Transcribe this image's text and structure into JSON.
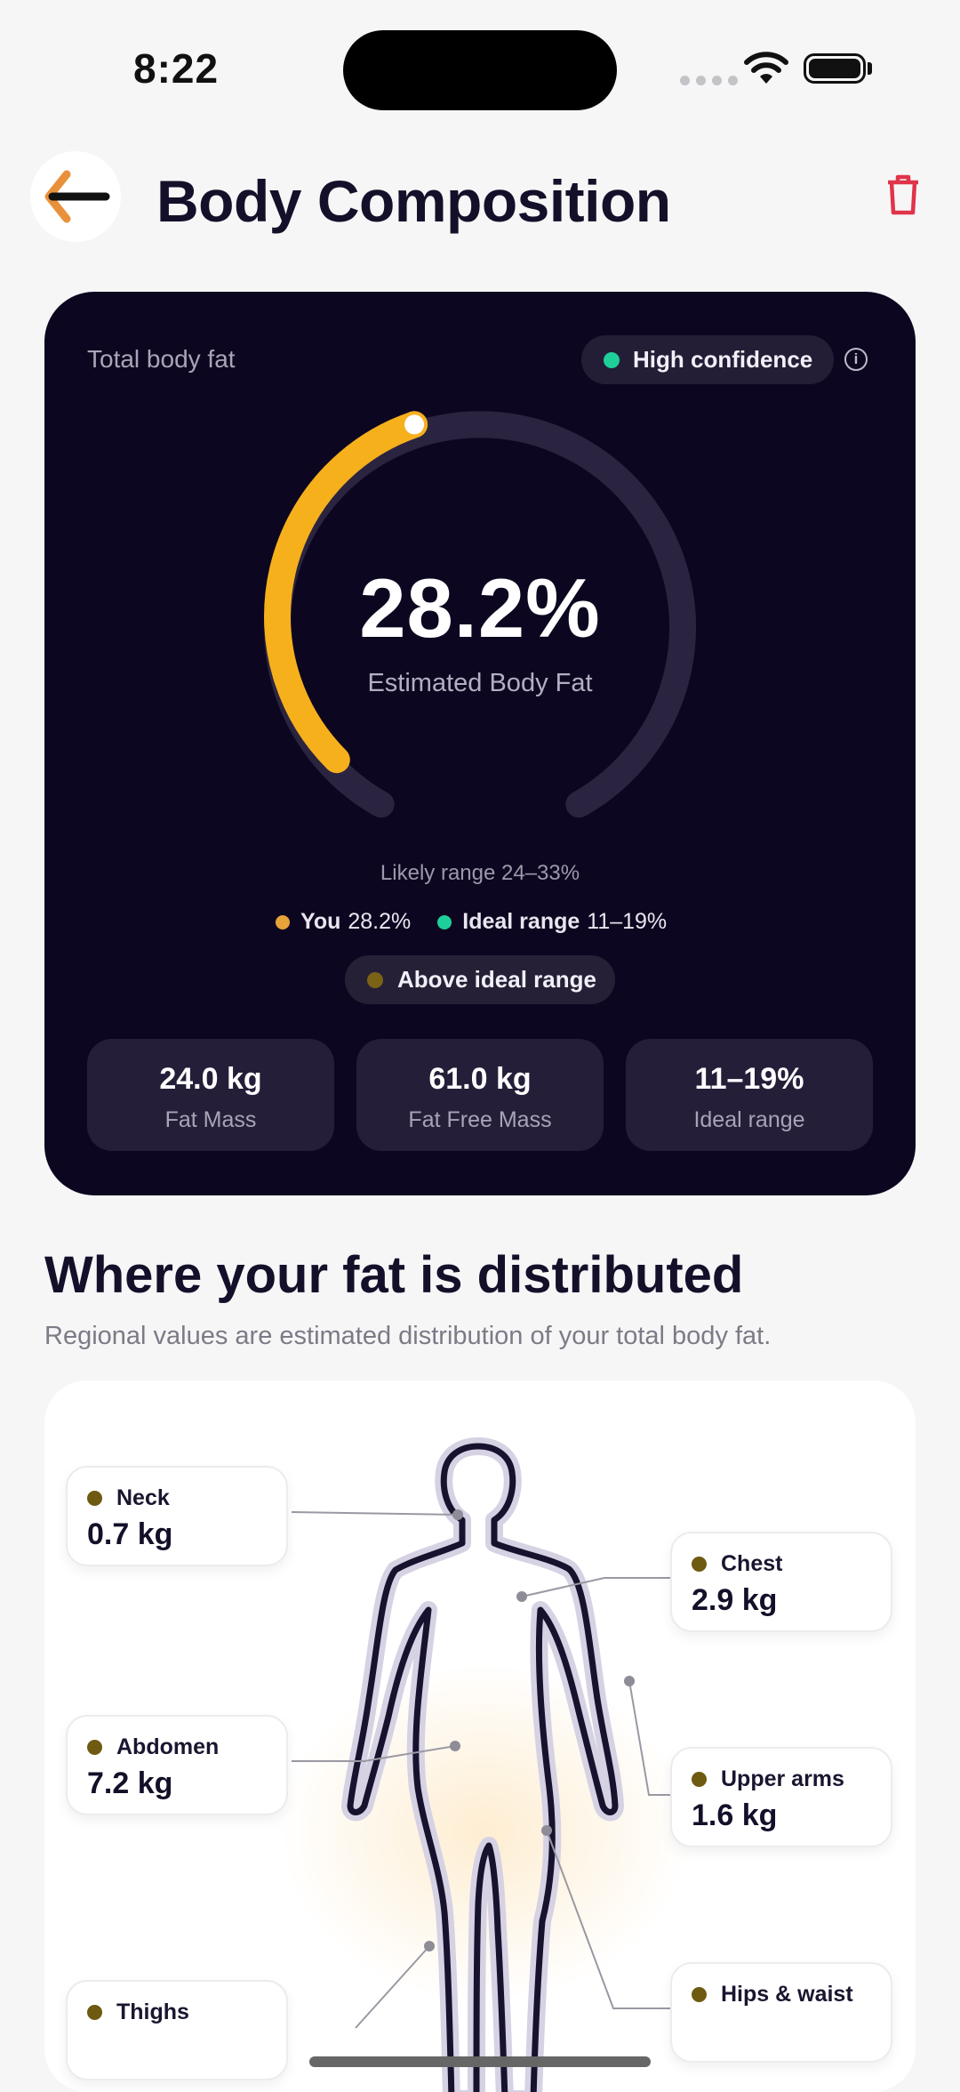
{
  "status_bar": {
    "time": "8:22"
  },
  "header": {
    "title": "Body Composition"
  },
  "card": {
    "label": "Total body fat",
    "confidence": "High confidence",
    "value": "28.2%",
    "value_label": "Estimated Body Fat",
    "gauge_fraction": 0.43,
    "likely_range": "Likely range  24–33%",
    "legend_you_label": "You",
    "legend_you_value": "28.2%",
    "legend_ideal_label": "Ideal range",
    "legend_ideal_value": "11–19%",
    "status": "Above ideal range",
    "tiles": [
      {
        "value": "24.0 kg",
        "label": "Fat Mass"
      },
      {
        "value": "61.0 kg",
        "label": "Fat Free Mass"
      },
      {
        "value": "11–19%",
        "label": "Ideal range"
      }
    ]
  },
  "distribution": {
    "title": "Where your fat is distributed",
    "subtitle": "Regional values are estimated distribution of your total body fat.",
    "regions": [
      {
        "name": "Neck",
        "value": "0.7 kg"
      },
      {
        "name": "Chest",
        "value": "2.9 kg"
      },
      {
        "name": "Abdomen",
        "value": "7.2 kg"
      },
      {
        "name": "Upper arms",
        "value": "1.6 kg"
      },
      {
        "name": "Thighs",
        "value": ""
      },
      {
        "name": "Hips & waist",
        "value": ""
      }
    ]
  },
  "colors": {
    "accent_orange": "#f5b01c",
    "ideal_green": "#1fcf9a",
    "card_bg": "#0d0620",
    "danger_red": "#e0344a"
  }
}
